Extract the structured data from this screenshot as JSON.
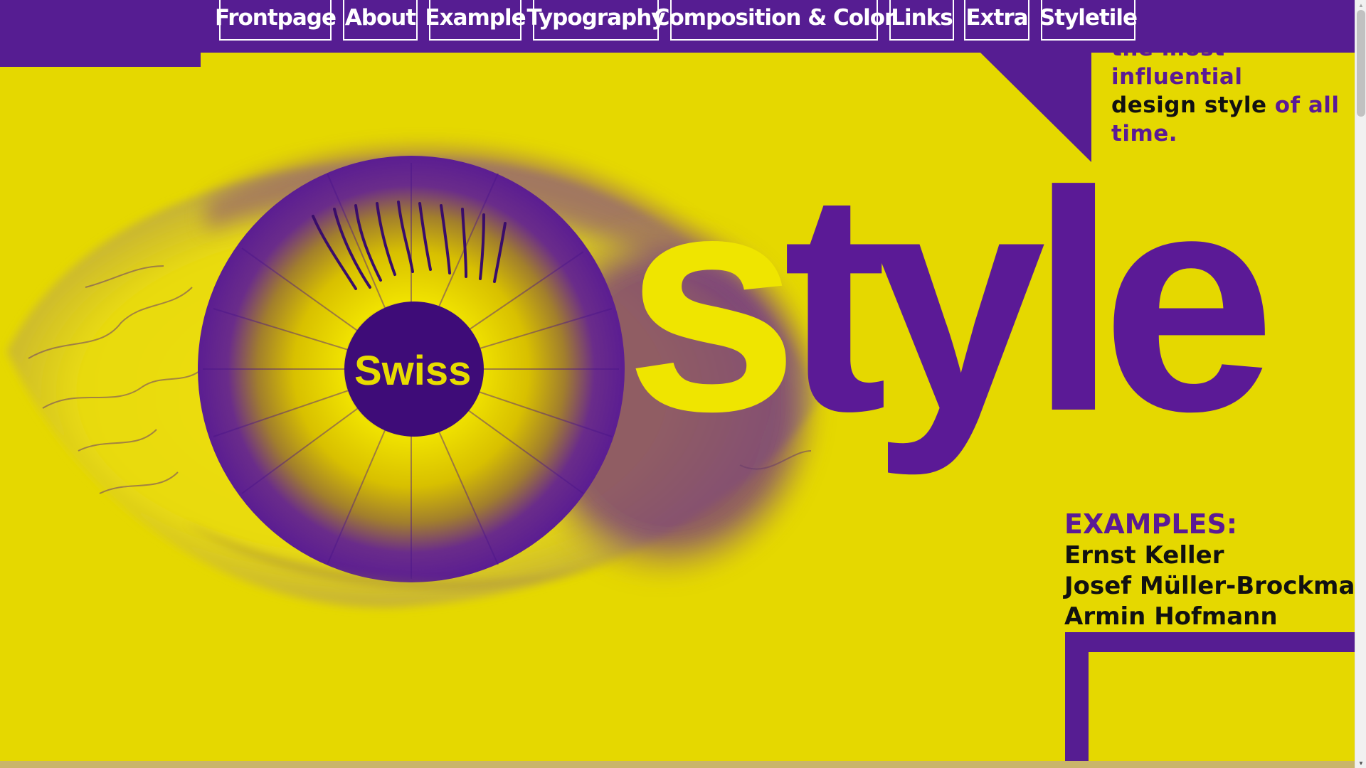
{
  "nav": {
    "items": [
      {
        "label": "Frontpage"
      },
      {
        "label": "About"
      },
      {
        "label": "Example"
      },
      {
        "label": "Typography"
      },
      {
        "label": "Composition & Color"
      },
      {
        "label": "Links"
      },
      {
        "label": "Extra"
      },
      {
        "label": "Styletile"
      }
    ]
  },
  "hero": {
    "pupil_text": "Swiss",
    "big_word_first": "s",
    "big_word_rest": "tyle"
  },
  "tagline": {
    "line1": "the most influential",
    "line2_dark": "design style",
    "line2_rest": " of all",
    "line3": "time."
  },
  "examples": {
    "title": "EXAMPLES:",
    "items": [
      "Ernst Keller",
      "Josef Müller-Brockmann",
      "Armin Hofmann"
    ]
  },
  "colors": {
    "background": "#e5d800",
    "purple": "#561d92",
    "accent_yellow": "#efe500",
    "text_dark": "#111111"
  },
  "icons": {
    "scroll_up": "triangle-up-icon",
    "scroll_down": "triangle-down-icon"
  }
}
